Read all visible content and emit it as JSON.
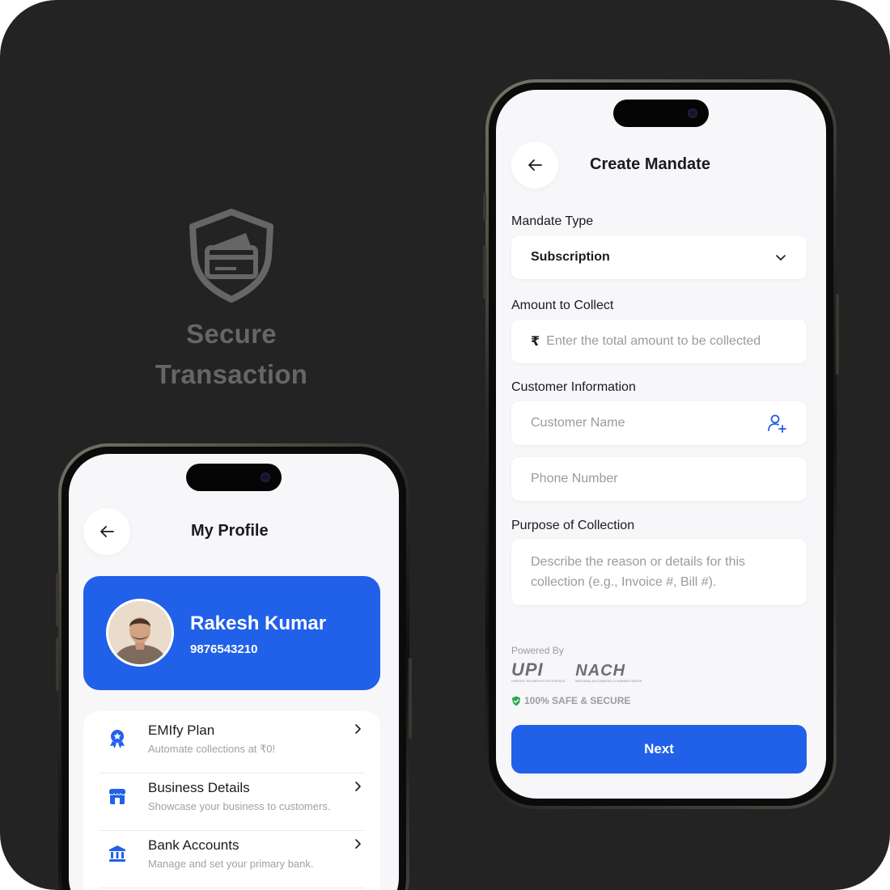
{
  "hero": {
    "icon": "shield-card-icon",
    "title_line1": "Secure",
    "title_line2": "Transaction"
  },
  "mandate_screen": {
    "title": "Create Mandate",
    "back_icon": "arrow-left-icon",
    "mandate_type": {
      "label": "Mandate Type",
      "value": "Subscription",
      "icon": "chevron-down-icon"
    },
    "amount": {
      "label": "Amount to Collect",
      "currency_symbol": "₹",
      "placeholder": "Enter the total amount to be collected"
    },
    "customer": {
      "label": "Customer Information",
      "name_placeholder": "Customer Name",
      "name_icon": "add-contact-icon",
      "phone_placeholder": "Phone Number"
    },
    "purpose": {
      "label": "Purpose of Collection",
      "placeholder": "Describe the reason or details for this collection (e.g., Invoice #, Bill #)."
    },
    "powered_by": "Powered By",
    "logos": {
      "upi": "UPI",
      "upi_sub": "UNIFIED PAYMENTS INTERFACE",
      "nach": "NACH",
      "nach_sub": "NATIONAL AUTOMATED CLEARING HOUSE"
    },
    "safe_text": "100% SAFE & SECURE",
    "next_label": "Next"
  },
  "profile_screen": {
    "title": "My Profile",
    "back_icon": "arrow-left-icon",
    "user": {
      "name": "Rakesh Kumar",
      "phone": "9876543210"
    },
    "menu": [
      {
        "title": "EMIfy Plan",
        "subtitle": "Automate collections at ₹0!",
        "icon": "badge-icon"
      },
      {
        "title": "Business Details",
        "subtitle": "Showcase your business to customers.",
        "icon": "store-icon"
      },
      {
        "title": "Bank Accounts",
        "subtitle": "Manage and set your primary bank.",
        "icon": "bank-icon"
      }
    ]
  },
  "colors": {
    "background": "#232323",
    "accent": "#2160e8",
    "screen": "#f7f7f9",
    "hero_text": "#666666"
  }
}
